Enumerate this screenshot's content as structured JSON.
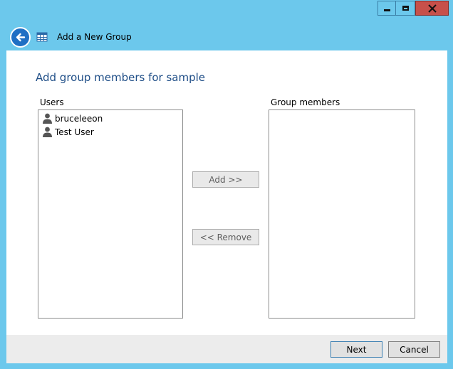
{
  "window": {
    "title": "Add a New Group",
    "controls": {
      "minimize": "minimize",
      "maximize": "maximize",
      "close": "close"
    }
  },
  "main": {
    "heading": "Add group members for sample",
    "users_label": "Users",
    "members_label": "Group members",
    "users": [
      {
        "name": "bruceleeon",
        "icon": "user-icon"
      },
      {
        "name": "Test User",
        "icon": "user-icon"
      }
    ],
    "group_members": [],
    "add_button": "Add >>",
    "remove_button": "<< Remove"
  },
  "footer": {
    "next_button": "Next",
    "cancel_button": "Cancel"
  },
  "colors": {
    "title_bar": "#6cc8ec",
    "close_button": "#c7504a",
    "heading": "#1f4e87",
    "back_button": "#1f6fc4"
  }
}
